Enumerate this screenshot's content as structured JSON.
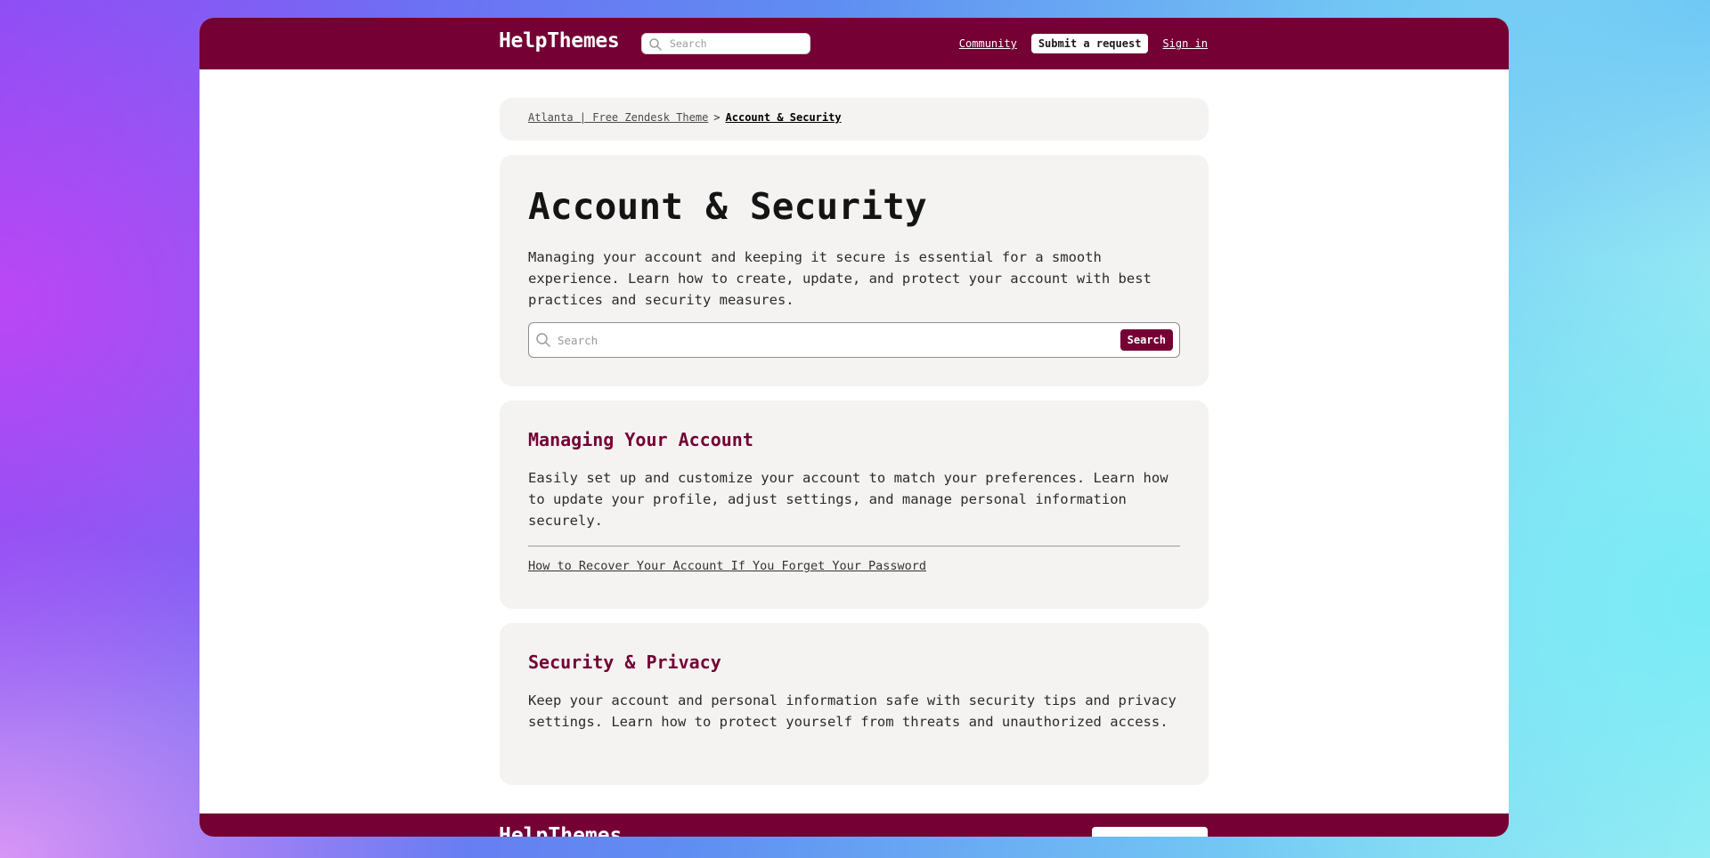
{
  "header": {
    "brand": "HelpThemes",
    "search_placeholder": "Search",
    "nav": {
      "community": "Community",
      "submit_request": "Submit a request",
      "sign_in": "Sign in"
    }
  },
  "breadcrumb": {
    "parent": "Atlanta | Free Zendesk Theme",
    "separator": ">",
    "current": "Account & Security"
  },
  "category": {
    "title": "Account & Security",
    "description": "Managing your account and keeping it secure is essential for a smooth experience. Learn how to create, update, and protect your account with best practices and security measures.",
    "search_placeholder": "Search",
    "search_button": "Search"
  },
  "sections": [
    {
      "title": "Managing Your Account",
      "description": "Easily set up and customize your account to match your preferences. Learn how to update your profile, adjust settings, and manage personal information securely.",
      "articles": [
        "How to Recover Your Account If You Forget Your Password"
      ]
    },
    {
      "title": "Security & Privacy",
      "description": "Keep your account and personal information safe with security tips and privacy settings. Learn how to protect yourself from threats and unauthorized access."
    }
  ],
  "footer": {
    "brand": "HelpThemes"
  },
  "colors": {
    "brand": "#740034",
    "card_bg": "#f5f3f2"
  },
  "icons": [
    "search-icon"
  ]
}
